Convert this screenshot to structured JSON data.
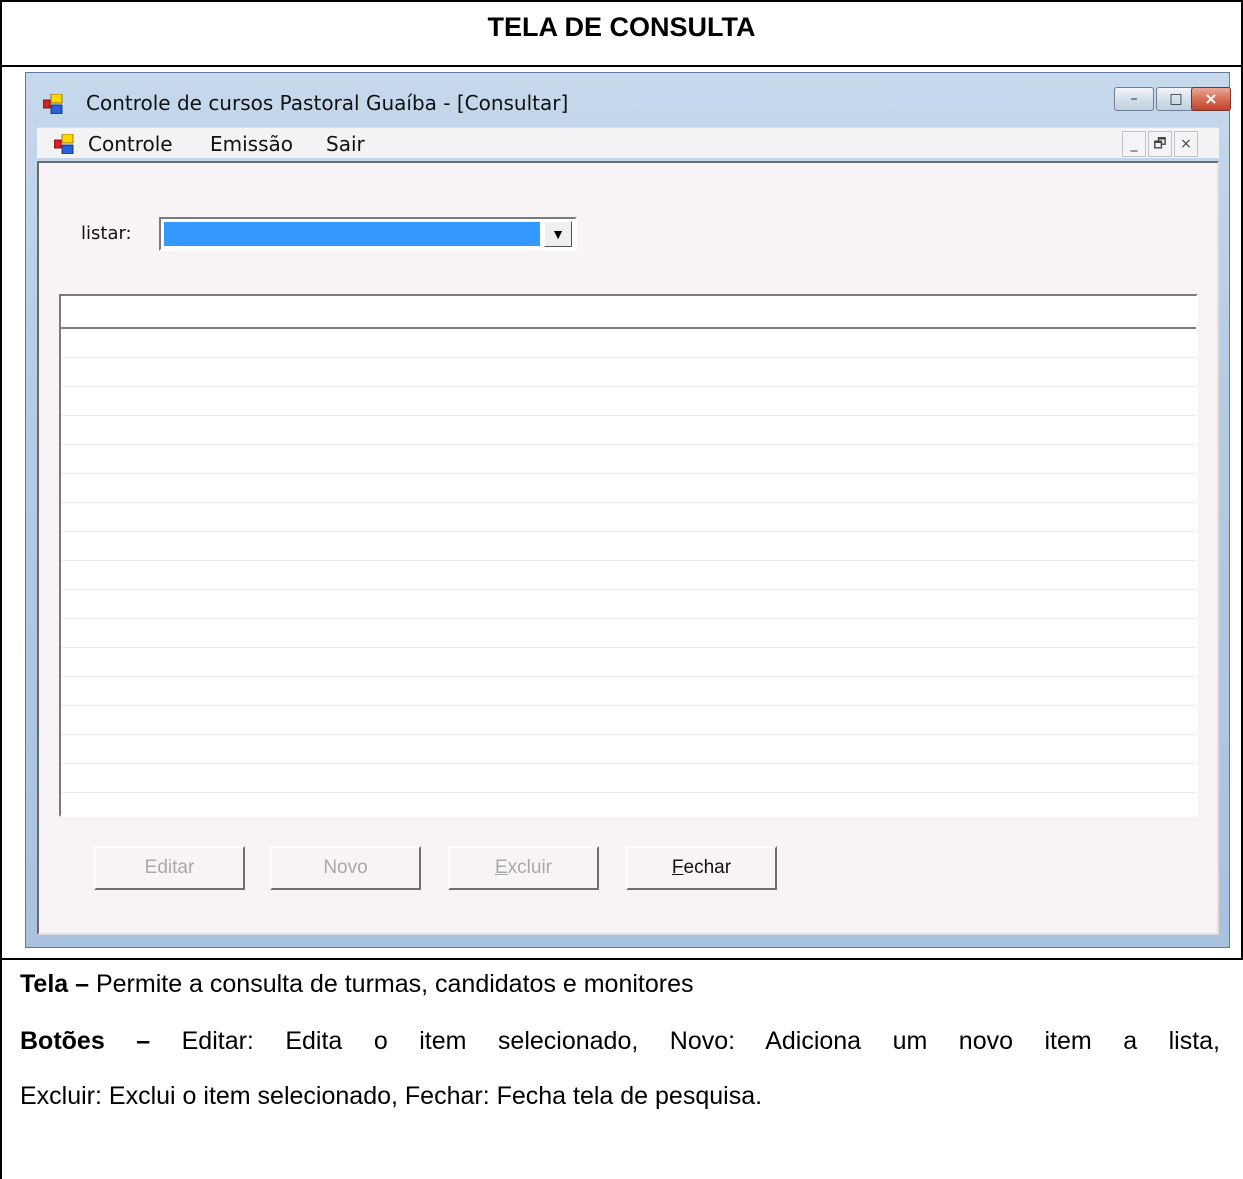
{
  "document": {
    "title": "TELA DE CONSULTA",
    "line1_label": "Tela –",
    "line1_text": " Permite a consulta de turmas, candidatos e monitores",
    "line2_label": "Botões –",
    "line2_text": " Editar: Edita o item selecionado, Novo: Adiciona um novo item a lista,",
    "line3_text": "Excluir: Exclui o item selecionado, Fechar: Fecha tela de pesquisa."
  },
  "window": {
    "title": "Controle de cursos Pastoral  Guaíba - [Consultar]",
    "app_icon": "app-icon",
    "caption_buttons": {
      "minimize": "–",
      "maximize": "□",
      "close": "×"
    }
  },
  "menu": {
    "items": [
      "Controle",
      "Emissão",
      "Sair"
    ],
    "mdi_buttons": {
      "minimize": "_",
      "restore": "🗗",
      "close": "×"
    }
  },
  "form": {
    "listar_label": "listar:",
    "listar_value": "",
    "buttons": [
      {
        "label": "Editar",
        "enabled": false
      },
      {
        "label": "Novo",
        "enabled": false
      },
      {
        "label": "Excluir",
        "enabled": false
      },
      {
        "label": "Fechar",
        "enabled": true
      }
    ]
  },
  "colors": {
    "selection": "#3399ff",
    "form_background": "#f7f3f6",
    "disabled_text": "#a9a9a9"
  }
}
